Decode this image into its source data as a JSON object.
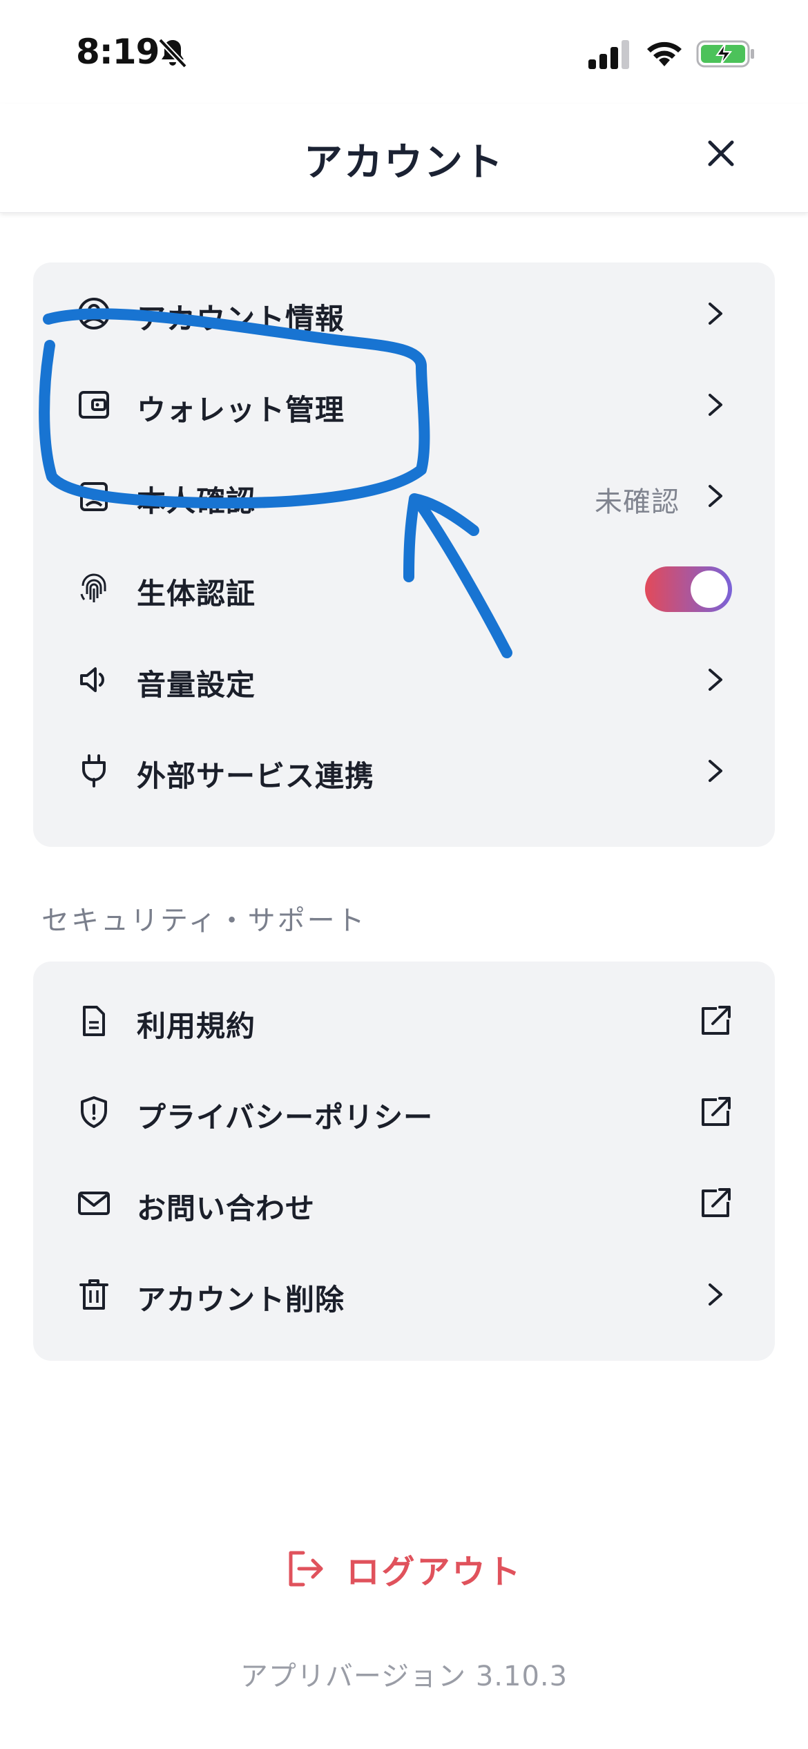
{
  "status_bar": {
    "time": "8:19",
    "icons": [
      "bell-slash-icon",
      "cellular-signal-icon",
      "wifi-icon",
      "battery-charging-icon"
    ]
  },
  "header": {
    "title": "アカウント",
    "close_icon": "close-icon"
  },
  "account_section": {
    "items": [
      {
        "label": "アカウント情報",
        "icon": "user-circle-icon",
        "trailing": "chevron"
      },
      {
        "label": "ウォレット管理",
        "icon": "wallet-icon",
        "trailing": "chevron"
      },
      {
        "label": "本人確認",
        "icon": "id-badge-icon",
        "trailing": "chevron",
        "value": "未確認"
      },
      {
        "label": "生体認証",
        "icon": "fingerprint-icon",
        "trailing": "toggle",
        "toggle_on": true
      },
      {
        "label": "音量設定",
        "icon": "speaker-icon",
        "trailing": "chevron"
      },
      {
        "label": "外部サービス連携",
        "icon": "plug-icon",
        "trailing": "chevron"
      }
    ]
  },
  "security_section": {
    "title": "セキュリティ・サポート",
    "items": [
      {
        "label": "利用規約",
        "icon": "document-icon",
        "trailing": "external-link"
      },
      {
        "label": "プライバシーポリシー",
        "icon": "shield-icon",
        "trailing": "external-link"
      },
      {
        "label": "お問い合わせ",
        "icon": "mail-icon",
        "trailing": "external-link"
      },
      {
        "label": "アカウント削除",
        "icon": "trash-icon",
        "trailing": "chevron"
      }
    ]
  },
  "logout": {
    "label": "ログアウト",
    "icon": "logout-icon"
  },
  "version": "アプリバージョン 3.10.3",
  "colors": {
    "accent_red": "#e0525c",
    "toggle_gradient_start": "#e24a5a",
    "toggle_gradient_end": "#7a63d8",
    "card_background": "#f2f3f5",
    "annotation_blue": "#1874d2"
  }
}
